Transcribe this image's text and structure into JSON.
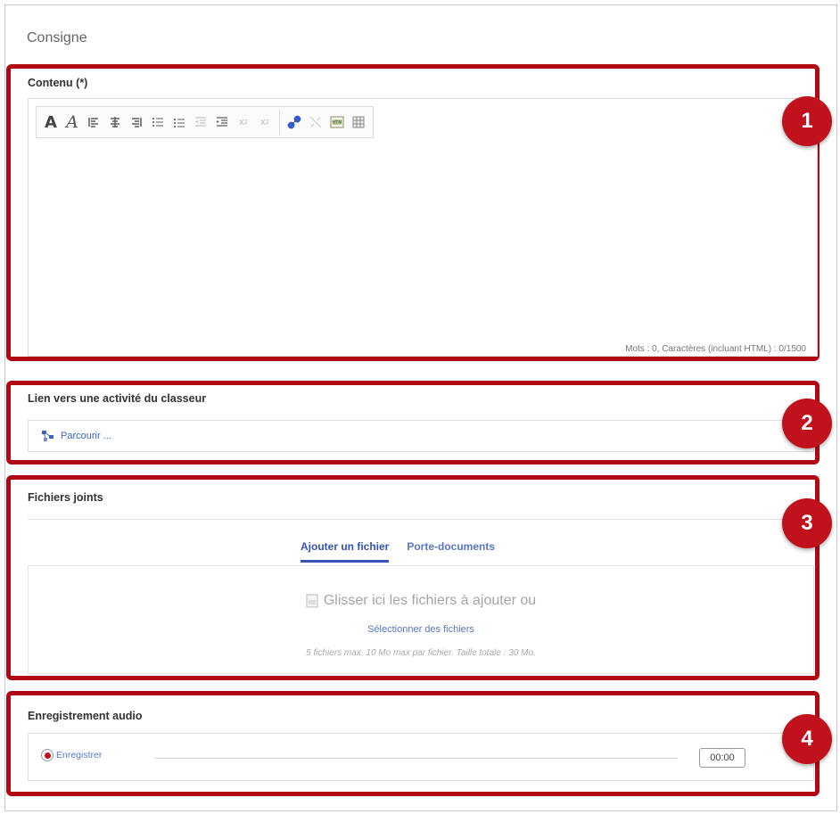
{
  "page": {
    "section_title": "Consigne"
  },
  "editor": {
    "label": "Contenu (*)",
    "word_count": "Mots : 0, Caractères (incluant HTML) : 0/1500",
    "toolbar_icons": [
      "bold-icon",
      "italic-icon",
      "align-left-icon",
      "align-center-icon",
      "align-right-icon",
      "ordered-list-icon",
      "unordered-list-icon",
      "outdent-icon",
      "indent-icon",
      "subscript-icon",
      "superscript-icon",
      "link-icon",
      "unlink-icon",
      "media-icon",
      "table-icon"
    ]
  },
  "link": {
    "label": "Lien vers une activité du classeur",
    "browse": "Parcourir ..."
  },
  "files": {
    "label": "Fichiers joints",
    "tabs": [
      {
        "label": "Ajouter un fichier",
        "active": true
      },
      {
        "label": "Porte-documents",
        "active": false
      }
    ],
    "drop_text": "Glisser ici les fichiers à ajouter ou",
    "select_link": "Sélectionner des fichiers",
    "limits": "5 fichiers max. 10 Mo max par fichier. Taille totale : 30 Mo."
  },
  "audio": {
    "label": "Enregistrement audio",
    "record": "Enregistrer",
    "timer": "00:00"
  },
  "badges": [
    "1",
    "2",
    "3",
    "4"
  ],
  "colors": {
    "highlight_red": "#b00914",
    "badge_red": "#c0111c",
    "link_blue": "#3a64c8",
    "tab_active_blue": "#3552b8"
  }
}
